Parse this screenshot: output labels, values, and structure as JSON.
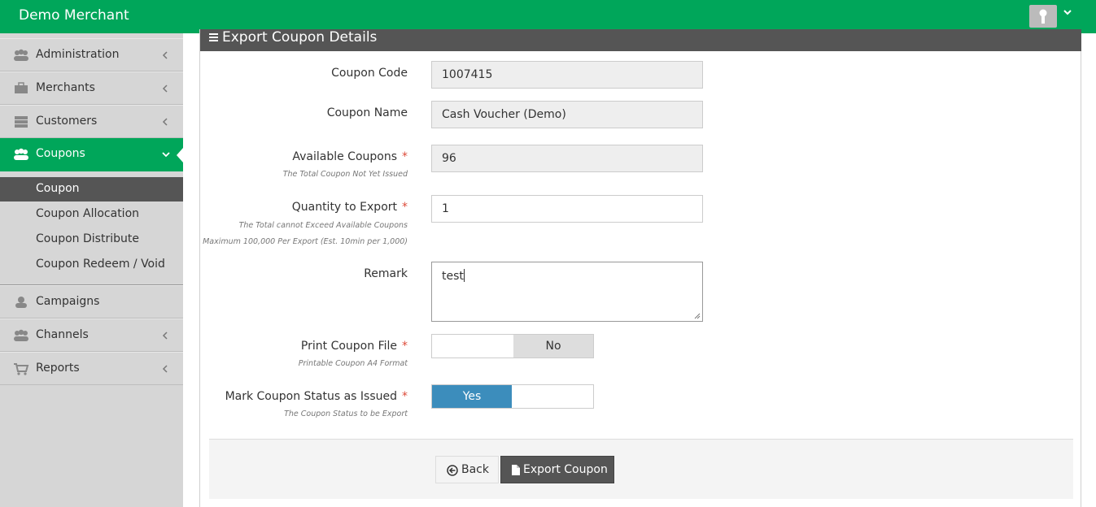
{
  "app": {
    "brand": "Demo Merchant"
  },
  "sidebar": {
    "items": [
      {
        "label": "Administration",
        "icon": "users-icon"
      },
      {
        "label": "Merchants",
        "icon": "briefcase-icon"
      },
      {
        "label": "Customers",
        "icon": "server-icon"
      },
      {
        "label": "Coupons",
        "icon": "users-icon"
      },
      {
        "label": "Campaigns",
        "icon": "user-icon"
      },
      {
        "label": "Channels",
        "icon": "users-icon"
      },
      {
        "label": "Reports",
        "icon": "cart-icon"
      }
    ],
    "coupon_subitems": [
      {
        "label": "Coupon"
      },
      {
        "label": "Coupon Allocation"
      },
      {
        "label": "Coupon Distribute"
      },
      {
        "label": "Coupon Redeem / Void"
      }
    ]
  },
  "panel": {
    "title": "Export Coupon Details"
  },
  "form": {
    "coupon_code": {
      "label": "Coupon Code",
      "value": "1007415"
    },
    "coupon_name": {
      "label": "Coupon Name",
      "value": "Cash Voucher (Demo)"
    },
    "available": {
      "label": "Available Coupons",
      "required": "*",
      "hint": "The Total Coupon Not Yet Issued",
      "value": "96"
    },
    "quantity": {
      "label": "Quantity to Export",
      "required": "*",
      "hint1": "The Total cannot Exceed Available Coupons",
      "hint2": "Maximum 100,000 Per Export (Est. 10min per 1,000)",
      "value": "1"
    },
    "remark": {
      "label": "Remark",
      "value": "test"
    },
    "print_file": {
      "label": "Print Coupon File",
      "required": "*",
      "hint": "Printable Coupon A4 Format",
      "value": "No"
    },
    "mark_issued": {
      "label": "Mark Coupon Status as Issued",
      "required": "*",
      "hint": "The Coupon Status to be Export",
      "value": "Yes"
    }
  },
  "actions": {
    "back": "Back",
    "export": "Export Coupon"
  },
  "colors": {
    "brand": "#00a65a",
    "toggle_on": "#3c8dbc",
    "header": "#555555",
    "required": "#dd4b39"
  }
}
